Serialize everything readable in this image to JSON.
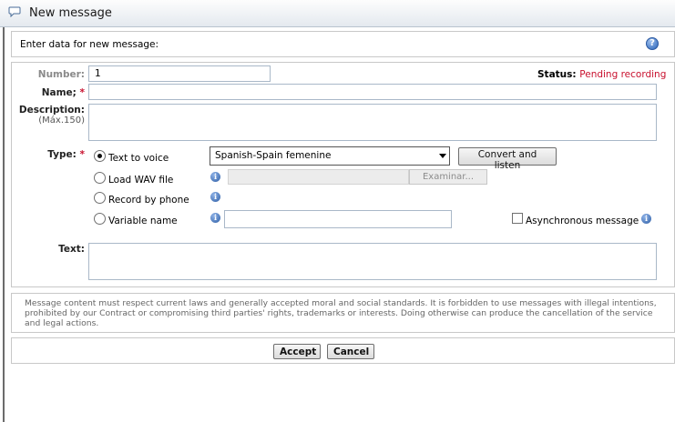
{
  "window": {
    "title": "New message",
    "icon": "speech-bubble-icon"
  },
  "header": {
    "text": "Enter data for new message:",
    "help_icon": "help-icon"
  },
  "form": {
    "number": {
      "label": "Number:",
      "value": "1"
    },
    "status": {
      "label": "Status:",
      "value": "Pending recording",
      "value_color": "#c8102e"
    },
    "name": {
      "label": "Name;",
      "required_mark": "*",
      "value": ""
    },
    "description": {
      "label": "Description:",
      "sublabel": "(Máx.150)",
      "value": ""
    },
    "type": {
      "label": "Type:",
      "required_mark": "*",
      "options": [
        {
          "label": "Text to voice",
          "checked": true
        },
        {
          "label": "Load WAV file",
          "checked": false
        },
        {
          "label": "Record by phone",
          "checked": false
        },
        {
          "label": "Variable name",
          "checked": false
        }
      ],
      "voice_select": "Spanish-Spain femenine",
      "convert_button": "Convert and listen",
      "browse_button": "Examinar...",
      "variable_value": "",
      "async_label": "Asynchronous message",
      "async_checked": false
    },
    "text": {
      "label": "Text:",
      "value": ""
    }
  },
  "disclaimer": "Message content must respect current laws and generally accepted moral and social standards. It is forbidden to use messages with illegal intentions, prohibited by our Contract or compromising third parties' rights, trademarks or interests. Doing otherwise can produce the cancellation of the service and legal actions.",
  "actions": {
    "accept": "Accept",
    "cancel": "Cancel"
  }
}
